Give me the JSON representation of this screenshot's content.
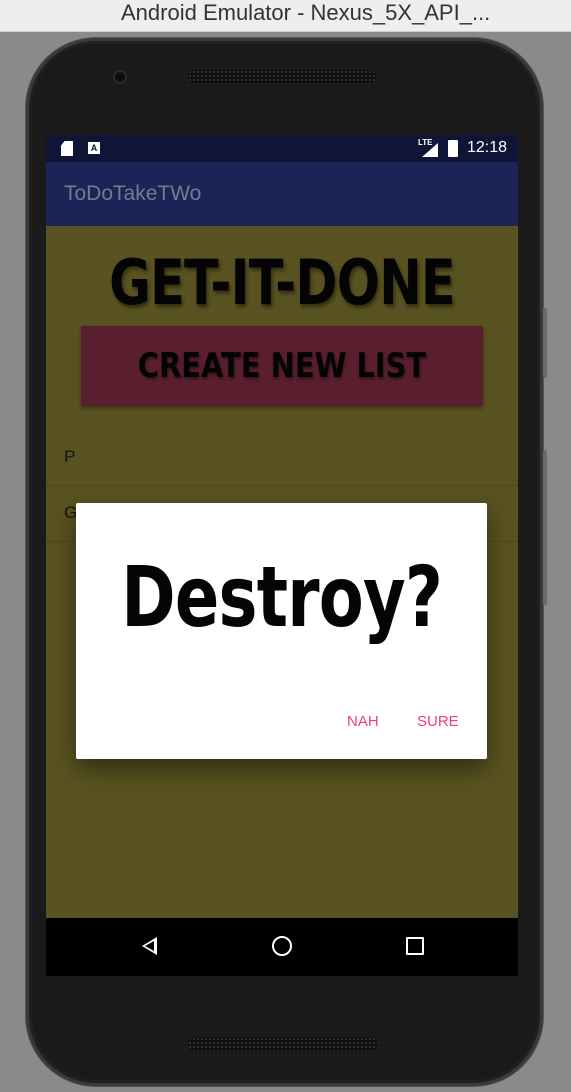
{
  "window": {
    "title": "Android Emulator - Nexus_5X_API_..."
  },
  "statusbar": {
    "sd_icon": "sd-card-icon",
    "a_icon": "A",
    "network": "LTE",
    "time": "12:18"
  },
  "appbar": {
    "title": "ToDoTakeTWo"
  },
  "main": {
    "headline": "GET-IT-DONE",
    "create_button": "CREATE NEW LIST",
    "list_items": [
      {
        "label": "P"
      },
      {
        "label": "G"
      }
    ]
  },
  "dialog": {
    "title": "Destroy?",
    "negative": "NAH",
    "positive": "SURE"
  },
  "navbar": {
    "back_icon": "back-icon",
    "home_icon": "home-icon",
    "recents_icon": "recents-icon"
  },
  "colors": {
    "background": "#5e5823",
    "appbar": "#1b2456",
    "statusbar": "#0f1536",
    "create_button": "#5e2131",
    "dialog_button": "#e8407e"
  }
}
